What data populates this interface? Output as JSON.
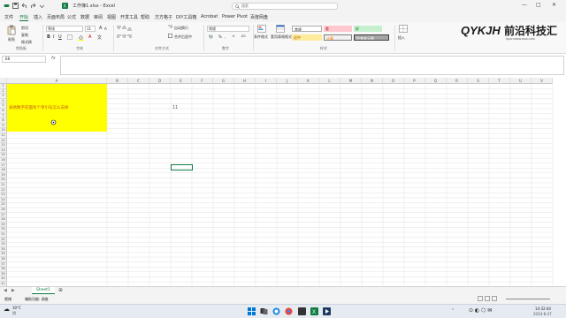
{
  "window": {
    "title": "工作簿1.xlsx - Excel",
    "search_placeholder": "搜索"
  },
  "menu": [
    "文件",
    "开始",
    "插入",
    "页面布局",
    "公式",
    "数据",
    "审阅",
    "视图",
    "开发工具",
    "帮助",
    "方方格子",
    "DIY工具箱",
    "Acrobat",
    "Power Pivot",
    "百度网盘"
  ],
  "ribbon": {
    "paste": "粘贴",
    "cut": "剪切",
    "copy": "复制",
    "format_painter": "格式刷",
    "clipboard_group": "剪贴板",
    "font_name": "等线",
    "font_size": "11",
    "font_group": "字体",
    "wrap_text": "自动换行",
    "merge_center": "合并后居中",
    "align_group": "对齐方式",
    "number_format": "常规",
    "number_group": "数字",
    "cond_format": "条件格式",
    "table_format": "套用表格格式",
    "styles_group": "样式",
    "styles": {
      "normal": "常规",
      "bad": "差",
      "good": "好",
      "neutral": "适中",
      "calc": "计算",
      "check": "检查单元格"
    },
    "insert": "插入"
  },
  "logo": {
    "text": "QYKJH前沿科技汇",
    "subtext": "QIANYANKEJIHUI.COM"
  },
  "formula_bar": {
    "name_box": "E8",
    "fx": "fx",
    "content": ""
  },
  "columns": [
    "A",
    "B",
    "C",
    "D",
    "E",
    "F",
    "G",
    "H",
    "I",
    "J",
    "K",
    "L",
    "M",
    "N",
    "O",
    "P",
    "Q",
    "R",
    "S",
    "T",
    "U",
    "V"
  ],
  "rows": [
    "1",
    "2",
    "3",
    "4",
    "5",
    "6",
    "7",
    "8",
    "9",
    "10",
    "11",
    "12",
    "13",
    "14",
    "15",
    "16",
    "17",
    "18",
    "19",
    "20",
    "21",
    "22",
    "23",
    "24",
    "25",
    "26",
    "27",
    "28",
    "29",
    "30",
    "31",
    "32",
    "33",
    "34",
    "35",
    "36",
    "37",
    "38",
    "39",
    "40",
    "41"
  ],
  "cells": {
    "a1_text": "表格数字前面有个单引号怎么去掉",
    "d1_value": "11"
  },
  "sheet_tabs": [
    "Sheet1"
  ],
  "status": {
    "ready": "就绪",
    "accessibility": "辅助功能: 调查"
  },
  "taskbar": {
    "weather_temp": "30°C",
    "weather_desc": "阴",
    "time": "14:32:44",
    "date": "2024-8-27"
  },
  "colors": {
    "excel_green": "#107c41",
    "highlight_yellow": "#ffff00",
    "text_orange": "#c65911"
  }
}
